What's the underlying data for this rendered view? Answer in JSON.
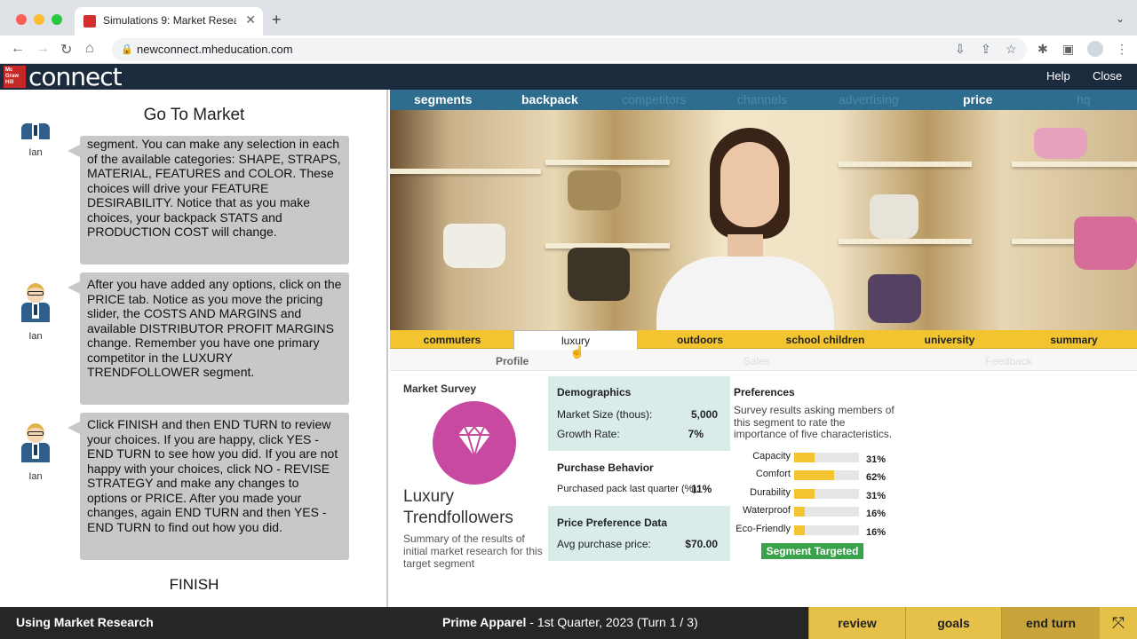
{
  "browser": {
    "tab_title": "Simulations 9: Market Research",
    "url": "newconnect.mheducation.com"
  },
  "header": {
    "logo_small": "Mc Graw Hill",
    "logo": "connect",
    "help": "Help",
    "close": "Close"
  },
  "chat": {
    "title": "Go To Market",
    "messages": [
      {
        "speaker": "Ian",
        "text": "segment. You can make any selection in each of the available categories: SHAPE, STRAPS, MATERIAL, FEATURES and COLOR. These choices will drive your FEATURE DESIRABILITY. Notice that as you make choices, your backpack STATS and PRODUCTION COST will change."
      },
      {
        "speaker": "Ian",
        "text": "After you have added any options, click on the PRICE tab. Notice as you move the pricing slider, the COSTS AND MARGINS and available DISTRIBUTOR PROFIT MARGINS change. Remember you have one primary competitor in the LUXURY TRENDFOLLOWER segment."
      },
      {
        "speaker": "Ian",
        "text": "Click FINISH and then END TURN to review your choices. If you are happy, click YES - END TURN to see how you did. If you are not happy with your choices, click NO - REVISE STRATEGY and make any changes to options or PRICE. After you made your changes, again END TURN and then YES - END TURN to find out how you did."
      }
    ],
    "finish": "FINISH"
  },
  "topnav": {
    "segments": "segments",
    "backpack": "backpack",
    "competitors": "competitors",
    "channels": "channels",
    "advertising": "advertising",
    "price": "price",
    "hq": "hq"
  },
  "segment_tabs": {
    "commuters": "commuters",
    "luxury": "luxury",
    "outdoors": "outdoors",
    "school_children": "school children",
    "university": "university",
    "summary": "summary"
  },
  "sub_tabs": {
    "profile": "Profile",
    "sales": "Sales",
    "feedback": "Feedback"
  },
  "market": {
    "survey_title": "Market Survey",
    "segment_name_line1": "Luxury",
    "segment_name_line2": "Trendfollowers",
    "summary": "Summary of the results of initial market research for this target segment",
    "demographics": {
      "title": "Demographics",
      "market_size_label": "Market Size (thous):",
      "market_size_value": "5,000",
      "growth_label": "Growth Rate:",
      "growth_value": "7%"
    },
    "purchase": {
      "title": "Purchase Behavior",
      "label": "Purchased pack last quarter (%):",
      "value": "11%"
    },
    "price_pref": {
      "title": "Price Preference Data",
      "label": "Avg purchase price:",
      "value": "$70.00"
    },
    "preferences": {
      "title": "Preferences",
      "description": "Survey results asking members of this segment to rate the importance of five characteristics.",
      "items": [
        {
          "label": "Capacity",
          "pct_text": "31%",
          "pct": 31
        },
        {
          "label": "Comfort",
          "pct_text": "62%",
          "pct": 62
        },
        {
          "label": "Durability",
          "pct_text": "31%",
          "pct": 31
        },
        {
          "label": "Waterproof",
          "pct_text": "16%",
          "pct": 16
        },
        {
          "label": "Eco-Friendly",
          "pct_text": "16%",
          "pct": 16
        }
      ]
    },
    "targeted_button": "Segment Targeted"
  },
  "bottom": {
    "left": "Using Market Research",
    "company": "Prime Apparel",
    "turn_info": " - 1st Quarter, 2023 (Turn 1 / 3)",
    "review": "review",
    "goals": "goals",
    "end_turn": "end turn"
  },
  "colors": {
    "nav_blue": "#2e6d8e",
    "tab_yellow": "#f2c430",
    "targeted_green": "#3aa24a",
    "diamond_magenta": "#c74aa0"
  }
}
